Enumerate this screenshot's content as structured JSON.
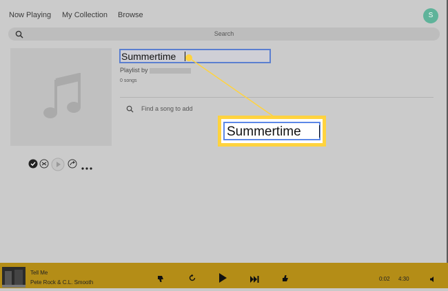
{
  "nav": {
    "tabs": [
      "Now Playing",
      "My Collection",
      "Browse"
    ],
    "avatar_letter": "S"
  },
  "search": {
    "placeholder": "Search"
  },
  "playlist": {
    "title": "Summertime",
    "by_label": "Playlist by",
    "song_count": "0 songs",
    "find_placeholder": "Find a song to add"
  },
  "callout": {
    "text": "Summertime"
  },
  "player": {
    "track_title": "Tell Me",
    "artist": "Pete Rock & C.L. Smooth",
    "elapsed": "0:02",
    "duration": "4:30"
  },
  "colors": {
    "accent": "#ffd33f",
    "player_bar": "#b48d17",
    "avatar": "#5fb39a",
    "input_border": "#5b7fd0"
  }
}
